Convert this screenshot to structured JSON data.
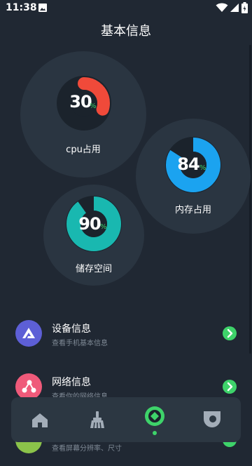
{
  "status_bar": {
    "time": "11:38"
  },
  "title": "基本信息",
  "gauges": [
    {
      "id": "cpu",
      "label": "cpu占用",
      "value": "30",
      "percent_sign": "%",
      "fraction": 0.3,
      "color": "#f04a3a"
    },
    {
      "id": "memory",
      "label": "内存占用",
      "value": "84",
      "percent_sign": "%",
      "fraction": 0.84,
      "color": "#1ba3f0"
    },
    {
      "id": "storage",
      "label": "储存空间",
      "value": "90",
      "percent_sign": "%",
      "fraction": 0.9,
      "color": "#19b8b0"
    }
  ],
  "list": [
    {
      "title": "设备信息",
      "subtitle": "查看手机基本信息",
      "icon": "triangle-logo-icon",
      "icon_color": "#5d5fd6"
    },
    {
      "title": "网络信息",
      "subtitle": "查看你的网络信息",
      "icon": "network-nodes-icon",
      "icon_color": "#ef5a7a"
    },
    {
      "title": "",
      "subtitle": "查看屏幕分辨率、尺寸",
      "icon": "screen-icon",
      "icon_color": "#8bc34a"
    }
  ],
  "bottom_nav": [
    {
      "icon": "home-icon"
    },
    {
      "icon": "broom-icon"
    },
    {
      "icon": "diamond-icon",
      "active": true
    },
    {
      "icon": "drop-icon"
    }
  ],
  "colors": {
    "background": "#202833",
    "card": "#2a3541",
    "accent": "#3ed36a",
    "nav": "#2c3742"
  }
}
